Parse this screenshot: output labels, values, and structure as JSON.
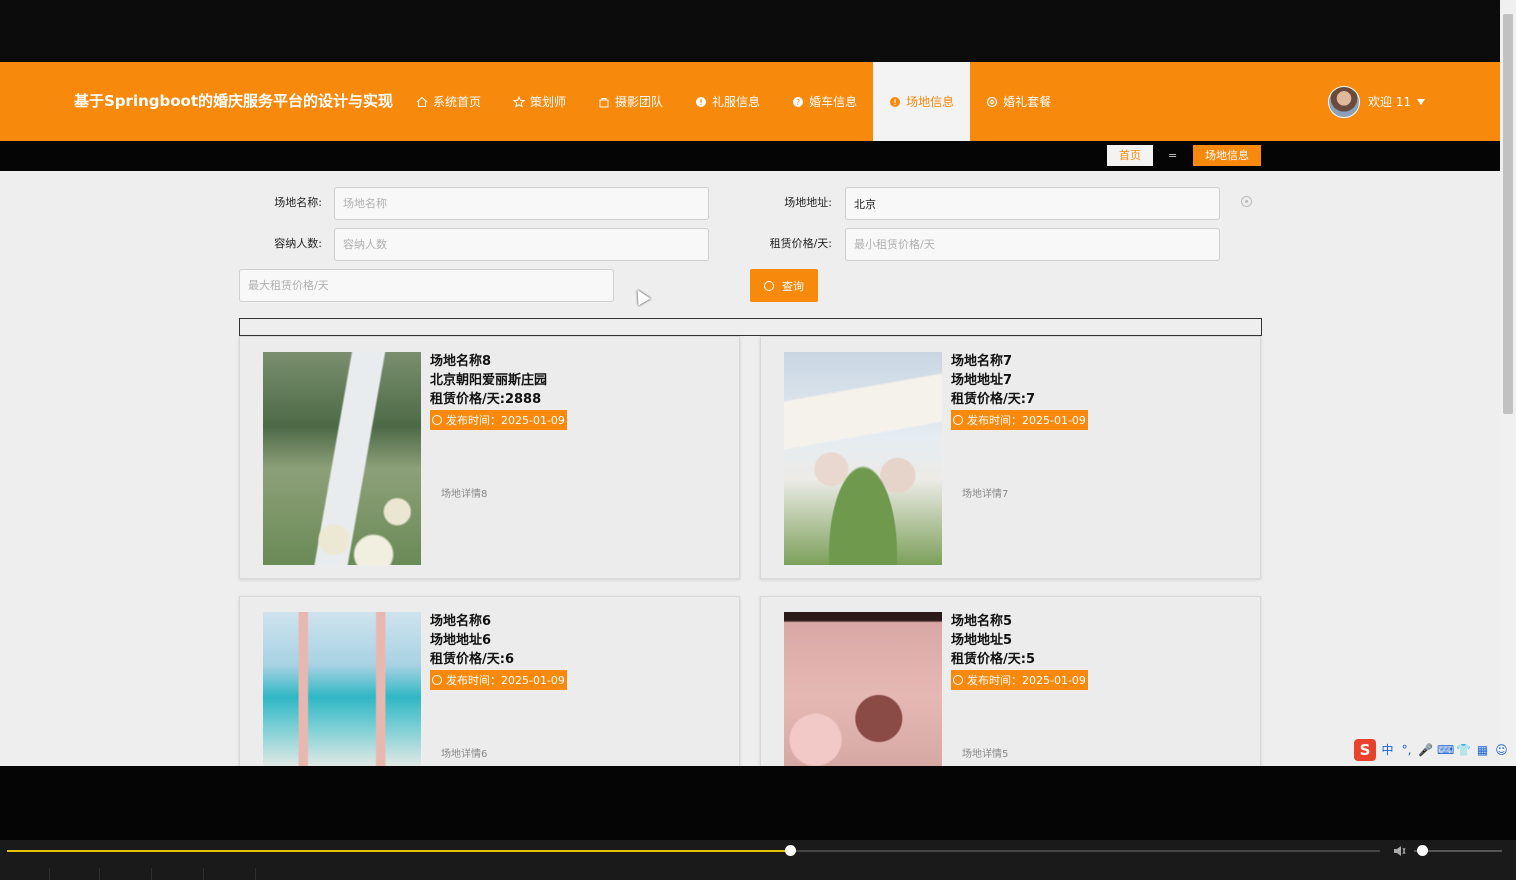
{
  "app": {
    "title": "基于Springboot的婚庆服务平台的设计与实现"
  },
  "nav": {
    "items": [
      {
        "label": "系统首页",
        "icon": "home-icon"
      },
      {
        "label": "策划师",
        "icon": "star-icon"
      },
      {
        "label": "摄影团队",
        "icon": "bag-icon"
      },
      {
        "label": "礼服信息",
        "icon": "info-icon"
      },
      {
        "label": "婚车信息",
        "icon": "question-icon"
      },
      {
        "label": "场地信息",
        "icon": "info-icon",
        "active": true
      },
      {
        "label": "婚礼套餐",
        "icon": "settings-icon"
      }
    ]
  },
  "user": {
    "greeting": "欢迎 11"
  },
  "breadcrumb": {
    "home": "首页",
    "separator": "=",
    "current": "场地信息"
  },
  "search": {
    "name_label": "场地名称:",
    "name_placeholder": "场地名称",
    "name_value": "",
    "address_label": "场地地址:",
    "address_value": "北京",
    "capacity_label": "容纳人数:",
    "capacity_placeholder": "容纳人数",
    "price_label": "租赁价格/天:",
    "min_price_placeholder": "最小租赁价格/天",
    "max_price_placeholder": "最大租赁价格/天",
    "button_label": "查询"
  },
  "venues": [
    {
      "name": "场地名称8",
      "address": "北京朝阳爱丽斯庄园",
      "price": "租赁价格/天:2888",
      "time": "发布时间：2025-01-09",
      "detail": "场地详情8"
    },
    {
      "name": "场地名称7",
      "address": "场地地址7",
      "price": "租赁价格/天:7",
      "time": "发布时间：2025-01-09",
      "detail": "场地详情7"
    },
    {
      "name": "场地名称6",
      "address": "场地地址6",
      "price": "租赁价格/天:6",
      "time": "发布时间：2025-01-09",
      "detail": "场地详情6"
    },
    {
      "name": "场地名称5",
      "address": "场地地址5",
      "price": "租赁价格/天:5",
      "time": "发布时间：2025-01-09",
      "detail": "场地详情5"
    }
  ],
  "player": {
    "progress": 0.57,
    "volume": 0.05
  },
  "ime": {
    "logo": "S",
    "items": [
      "中",
      "°,",
      "🎤",
      "⌨",
      "👕",
      "▦",
      "☺"
    ]
  },
  "colors": {
    "accent": "#f7890d",
    "header_text": "#ffffff"
  }
}
